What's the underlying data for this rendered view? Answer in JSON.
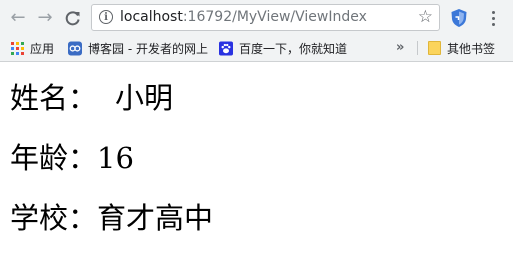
{
  "browser": {
    "url_host": "localhost",
    "url_path": ":16792/MyView/ViewIndex",
    "nav": {
      "back": "←",
      "forward": "→",
      "reload": "C"
    },
    "info_icon": "i",
    "star_icon": "☆",
    "bookmarks": {
      "apps_label": "应用",
      "items": [
        {
          "label": "博客园 - 开发者的网上",
          "icon": "cnblogs-icon"
        },
        {
          "label": "百度一下，你就知道",
          "icon": "baidu-paw-icon"
        }
      ],
      "overflow": "»",
      "other_label": "其他书签"
    }
  },
  "page": {
    "fields": [
      {
        "label": "姓名：",
        "value": "小明"
      },
      {
        "label": "年龄：",
        "value": "16"
      },
      {
        "label": "学校：",
        "value": "育才高中"
      }
    ]
  },
  "colors": {
    "chrome_bg": "#f1f3f4",
    "apps": [
      "#ea4335",
      "#fbbc05",
      "#34a853",
      "#4285f4"
    ],
    "cnblogs": "#3b6cc4",
    "baidu": "#2932e1",
    "extension_shield": "#3c78d8"
  }
}
